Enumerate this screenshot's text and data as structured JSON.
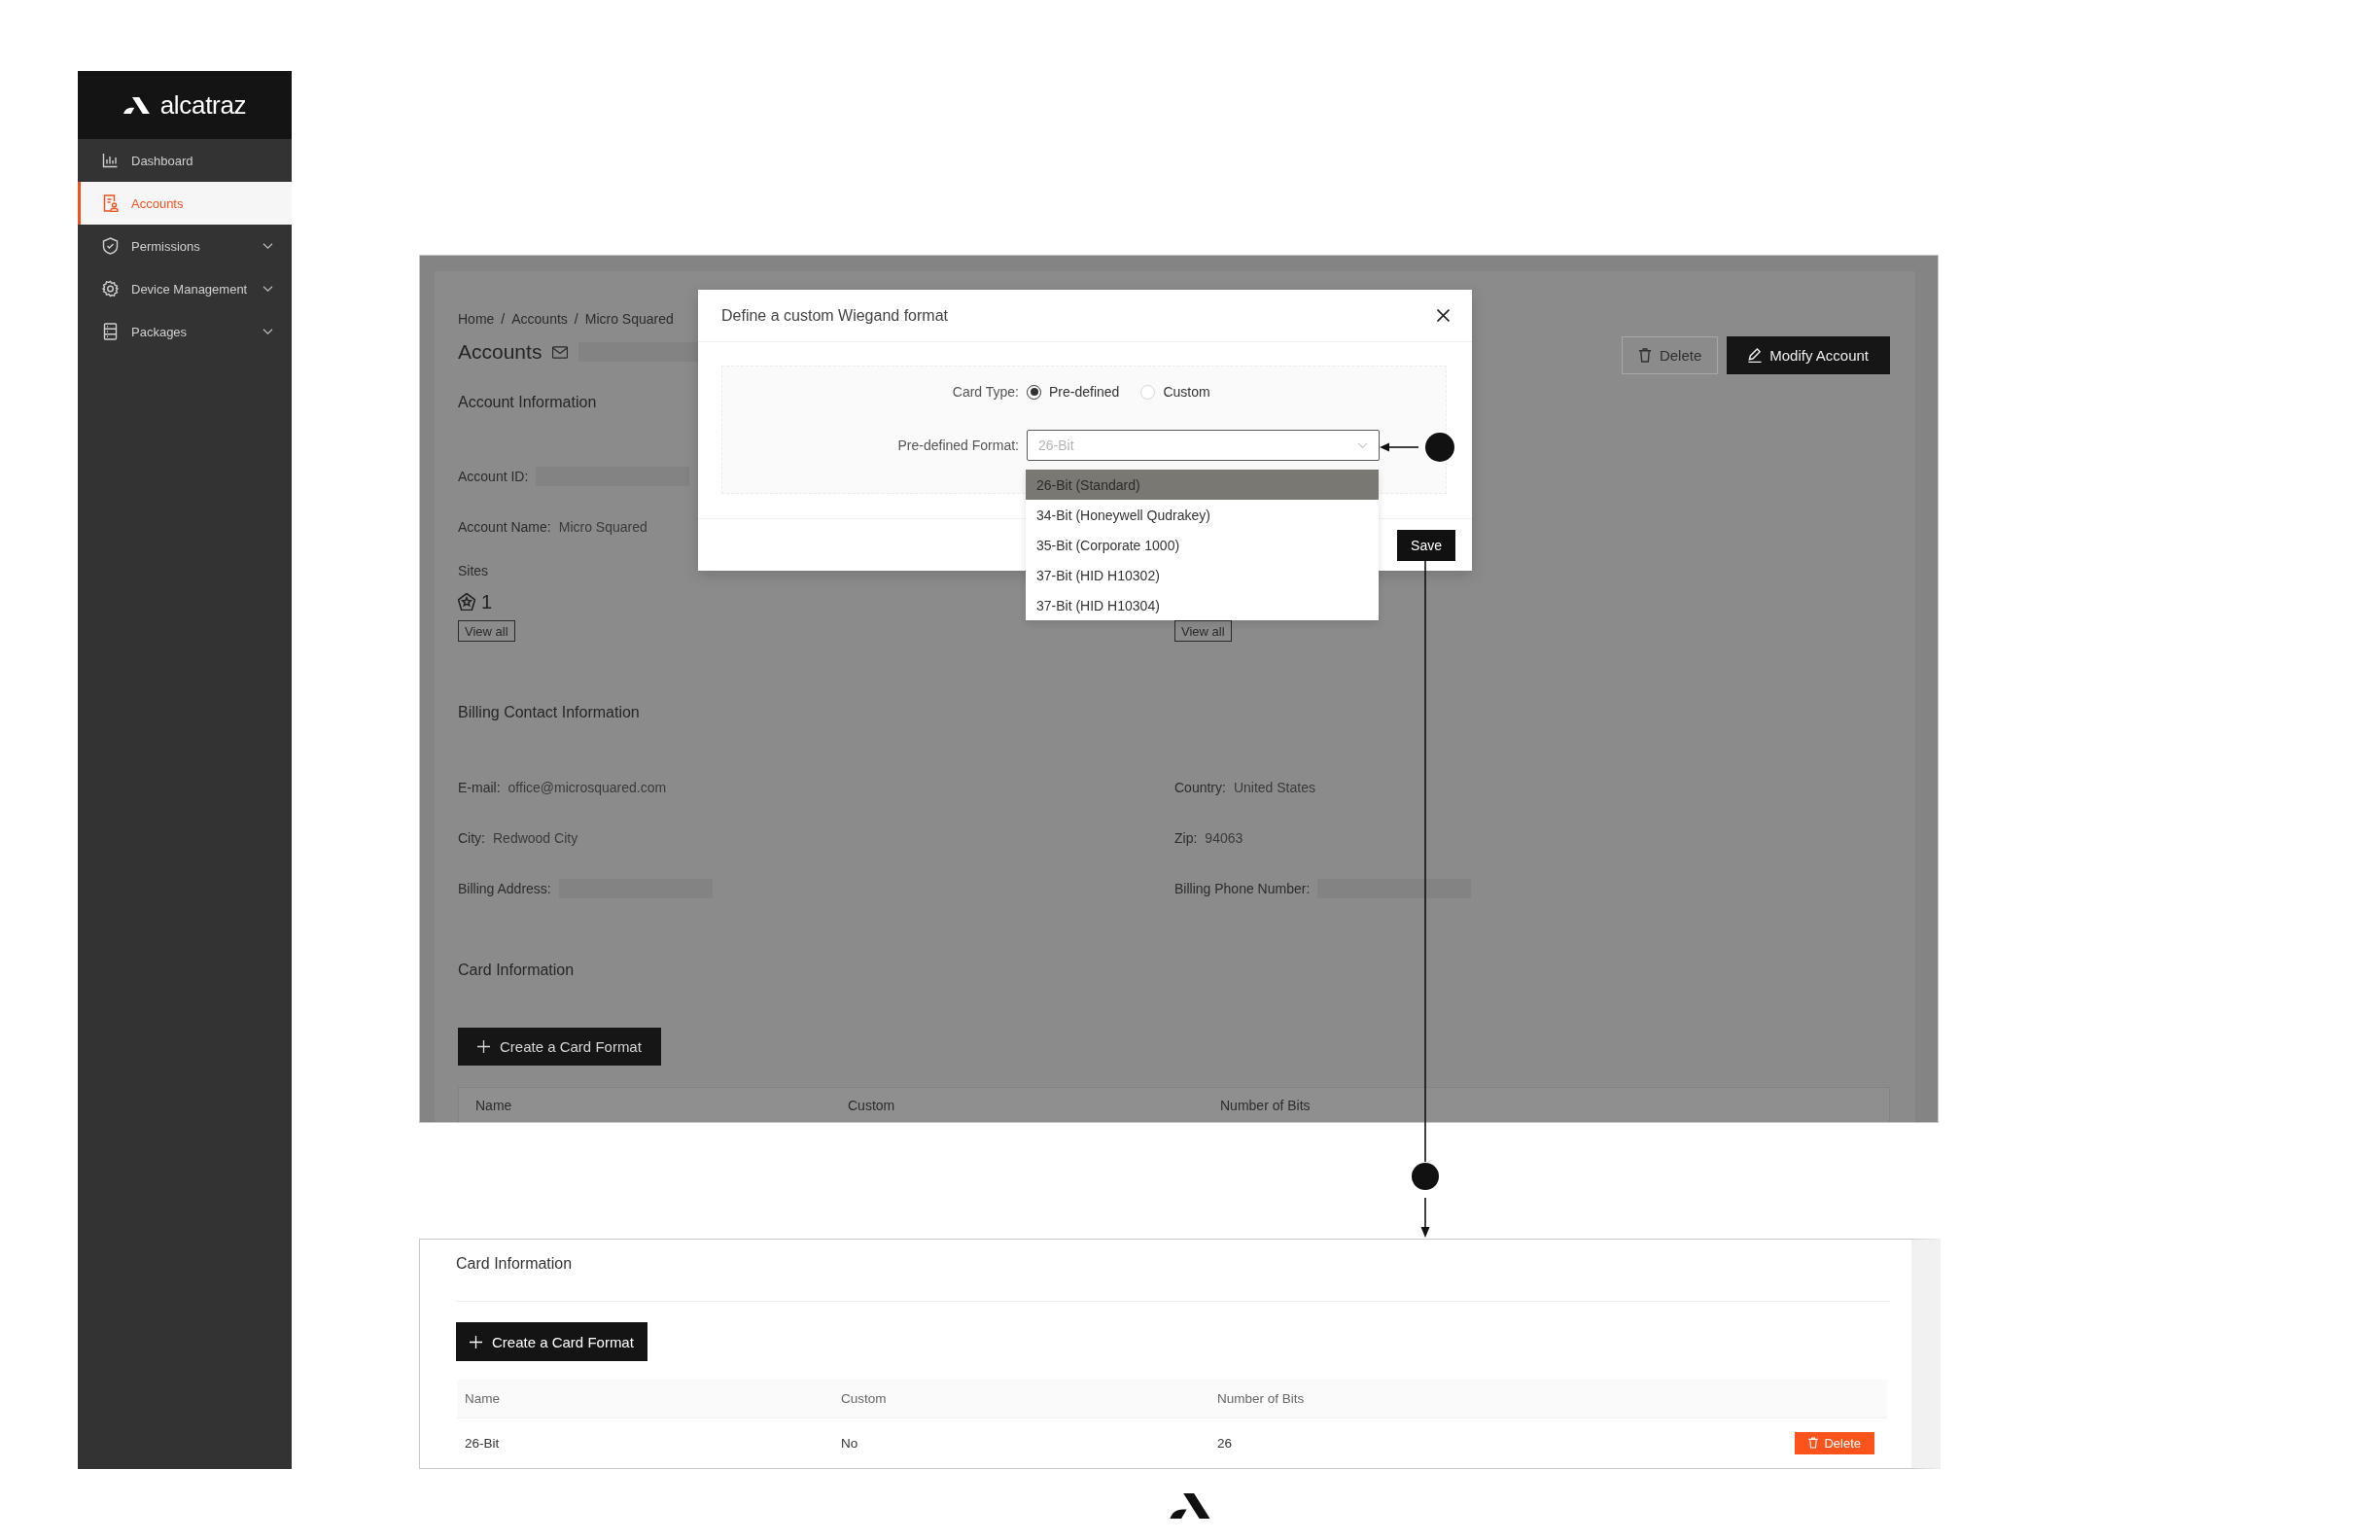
{
  "sidebar": {
    "brand": "alcatraz",
    "items": [
      {
        "label": "Dashboard",
        "selected": false,
        "expandable": false
      },
      {
        "label": "Accounts",
        "selected": true,
        "expandable": false
      },
      {
        "label": "Permissions",
        "selected": false,
        "expandable": true
      },
      {
        "label": "Device Management",
        "selected": false,
        "expandable": true
      },
      {
        "label": "Packages",
        "selected": false,
        "expandable": true
      }
    ]
  },
  "account_page": {
    "breadcrumb": {
      "items": [
        "Home",
        "Accounts",
        "Micro Squared"
      ],
      "separator": "/"
    },
    "title": "Accounts",
    "title_detail_redacted": true,
    "actions": [
      {
        "label": "Delete",
        "kind": "outline"
      },
      {
        "label": "Modify Account",
        "kind": "primary"
      }
    ],
    "account_information": {
      "heading": "Account Information",
      "fields": [
        {
          "label": "Account ID:",
          "redacted": true
        },
        {
          "label": "Account Name:",
          "value": "Micro Squared",
          "redacted": false
        }
      ],
      "sites": {
        "label": "Sites",
        "count": "1",
        "button": "View all"
      },
      "column_2": {
        "button": "View all"
      }
    },
    "billing_contact": {
      "heading": "Billing Contact Information",
      "columns": [
        {
          "fields": [
            {
              "label": "E-mail:",
              "value": "office@microsquared.com",
              "redacted": false
            },
            {
              "label": "City:",
              "value": "Redwood City",
              "redacted": false
            },
            {
              "label": "Billing Address:",
              "redacted": true
            }
          ]
        },
        {
          "fields": [
            {
              "label": "Country:",
              "value": "United States",
              "redacted": false
            },
            {
              "label": "Zip:",
              "value": "94063",
              "redacted": false
            },
            {
              "label": "Billing Phone Number:",
              "redacted": true
            }
          ]
        }
      ]
    },
    "card_information": {
      "heading": "Card Information",
      "button": "Create a Card Format",
      "columns": [
        "Name",
        "Custom",
        "Number of Bits"
      ]
    },
    "modal": {
      "title": "Define a custom Wiegand format",
      "card_type": {
        "label": "Card Type:",
        "options": [
          {
            "label": "Pre-defined",
            "selected": true
          },
          {
            "label": "Custom",
            "selected": false
          }
        ]
      },
      "format": {
        "label": "Pre-defined Format:",
        "placeholder": "26-Bit",
        "options": [
          {
            "label": "26-Bit (Standard)",
            "selected": true
          },
          {
            "label": "34-Bit (Honeywell Qudrakey)",
            "selected": false
          },
          {
            "label": "35-Bit (Corporate 1000)",
            "selected": false
          },
          {
            "label": "37-Bit (HID H10302)",
            "selected": false
          },
          {
            "label": "37-Bit (HID H10304)",
            "selected": false
          }
        ]
      },
      "buttons": [
        {
          "label": "Save",
          "kind": "primary"
        }
      ]
    }
  },
  "card_information_panel": {
    "heading": "Card Information",
    "button": "Create a Card Format",
    "table": {
      "columns": [
        "Name",
        "Custom",
        "Number of Bits"
      ],
      "rows": [
        {
          "cells": [
            "26-Bit",
            "No",
            "26"
          ],
          "action": "Delete"
        }
      ]
    }
  }
}
